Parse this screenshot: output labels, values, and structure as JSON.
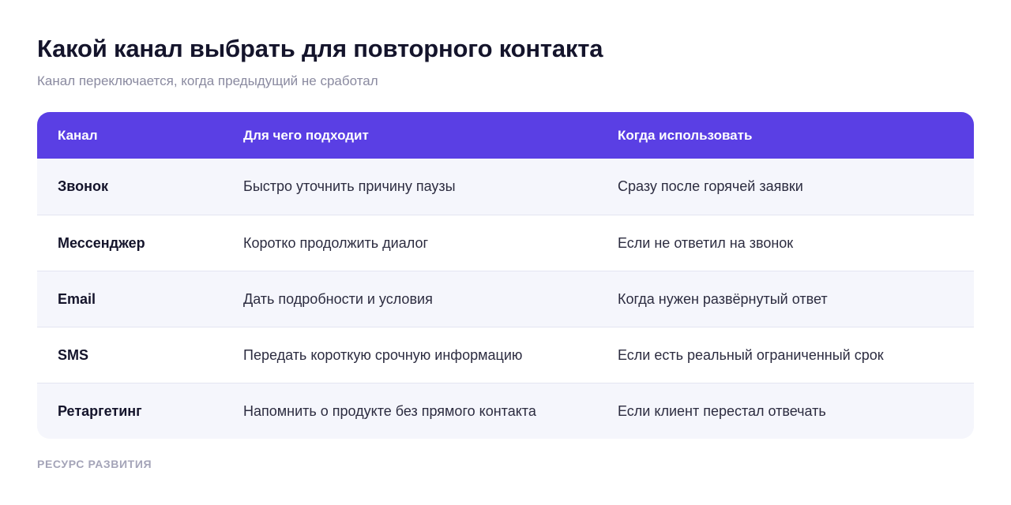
{
  "title": "Какой канал выбрать для повторного контакта",
  "subtitle": "Канал переключается, когда предыдущий не сработал",
  "table": {
    "headers": [
      "Канал",
      "Для чего подходит",
      "Когда использовать"
    ],
    "rows": [
      [
        "Звонок",
        "Быстро уточнить причину паузы",
        "Сразу после горячей заявки"
      ],
      [
        "Мессенджер",
        "Коротко продолжить диалог",
        "Если не ответил на звонок"
      ],
      [
        "Email",
        "Дать подробности и условия",
        "Когда нужен развёрнутый ответ"
      ],
      [
        "SMS",
        "Передать короткую срочную информацию",
        "Если есть реальный ограниченный срок"
      ],
      [
        "Ретаргетинг",
        "Напомнить о продукте без прямого контакта",
        "Если клиент перестал отвечать"
      ]
    ]
  },
  "footer": "РЕСУРС РАЗВИТИЯ",
  "colors": {
    "header_bg": "#5a3fe4",
    "stripe_bg": "#f5f6fc",
    "title_text": "#14142b",
    "muted_text": "#8a8aa0"
  }
}
